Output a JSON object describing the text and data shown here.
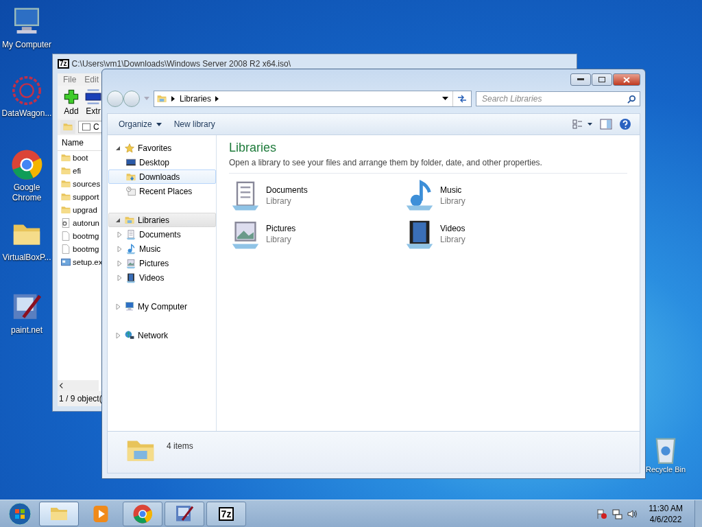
{
  "desktop_icons": [
    {
      "label": "My Computer",
      "kind": "computer"
    },
    {
      "label": "DataWagon...",
      "kind": "star-burst"
    },
    {
      "label": "Google Chrome",
      "kind": "chrome"
    },
    {
      "label": "VirtualBoxP...",
      "kind": "folder"
    },
    {
      "label": "paint.net",
      "kind": "paint"
    }
  ],
  "recycle_bin": {
    "label": "Recycle Bin"
  },
  "archive_window": {
    "logo": "7z",
    "title": "C:\\Users\\vm1\\Downloads\\Windows Server 2008 R2 x64.iso\\",
    "menu": [
      "File",
      "Edit"
    ],
    "toolbar": [
      {
        "label": "Add",
        "kind": "add"
      },
      {
        "label": "Extr",
        "kind": "extract"
      }
    ],
    "address": "C",
    "column_1": "Name",
    "files": [
      {
        "name": "boot",
        "kind": "folder"
      },
      {
        "name": "efi",
        "kind": "folder"
      },
      {
        "name": "sources",
        "kind": "folder"
      },
      {
        "name": "support",
        "kind": "folder"
      },
      {
        "name": "upgrad",
        "kind": "folder"
      },
      {
        "name": "autorun",
        "kind": "settings"
      },
      {
        "name": "bootmg",
        "kind": "file"
      },
      {
        "name": "bootmg",
        "kind": "file"
      },
      {
        "name": "setup.ex",
        "kind": "exe"
      }
    ],
    "status": "1 / 9 object("
  },
  "explorer": {
    "breadcrumb": [
      "Libraries"
    ],
    "search": {
      "placeholder": "Search Libraries"
    },
    "commands": [
      {
        "label": "Organize",
        "dropdown": true
      },
      {
        "label": "New library",
        "dropdown": false
      }
    ],
    "nav": [
      {
        "label": "Favorites",
        "kind": "star",
        "expanded": true,
        "selected": false,
        "hovered": false,
        "children": [
          {
            "label": "Desktop",
            "kind": "desktop",
            "selected": false,
            "hovered": false
          },
          {
            "label": "Downloads",
            "kind": "downloads",
            "selected": false,
            "hovered": true
          },
          {
            "label": "Recent Places",
            "kind": "recent",
            "selected": false,
            "hovered": false
          }
        ]
      },
      {
        "label": "Libraries",
        "kind": "library",
        "expanded": true,
        "selected": true,
        "hovered": false,
        "children": [
          {
            "label": "Documents",
            "kind": "documents",
            "expanded": false,
            "selected": false,
            "hovered": false
          },
          {
            "label": "Music",
            "kind": "music",
            "expanded": false,
            "selected": false,
            "hovered": false
          },
          {
            "label": "Pictures",
            "kind": "pictures",
            "expanded": false,
            "selected": false,
            "hovered": false
          },
          {
            "label": "Videos",
            "kind": "videos",
            "expanded": false,
            "selected": false,
            "hovered": false
          }
        ]
      },
      {
        "label": "My Computer",
        "kind": "computer",
        "expanded": false,
        "selected": false,
        "hovered": false
      },
      {
        "label": "Network",
        "kind": "network",
        "expanded": false,
        "selected": false,
        "hovered": false
      }
    ],
    "heading": "Libraries",
    "description": "Open a library to see your files and arrange them by folder, date, and other properties.",
    "libraries": [
      {
        "name": "Documents",
        "type": "Library",
        "kind": "documents"
      },
      {
        "name": "Music",
        "type": "Library",
        "kind": "music"
      },
      {
        "name": "Pictures",
        "type": "Library",
        "kind": "pictures"
      },
      {
        "name": "Videos",
        "type": "Library",
        "kind": "videos"
      }
    ],
    "status": "4 items"
  },
  "taskbar": {
    "buttons": [
      {
        "kind": "explorer",
        "selected": true,
        "running": true
      },
      {
        "kind": "media",
        "selected": false,
        "running": false
      },
      {
        "kind": "chrome",
        "selected": false,
        "running": true
      },
      {
        "kind": "paint",
        "selected": false,
        "running": true
      },
      {
        "kind": "archiver",
        "label": "7z",
        "selected": false,
        "running": true
      }
    ],
    "clock": {
      "time": "11:30 AM",
      "date": "4/6/2022"
    }
  }
}
